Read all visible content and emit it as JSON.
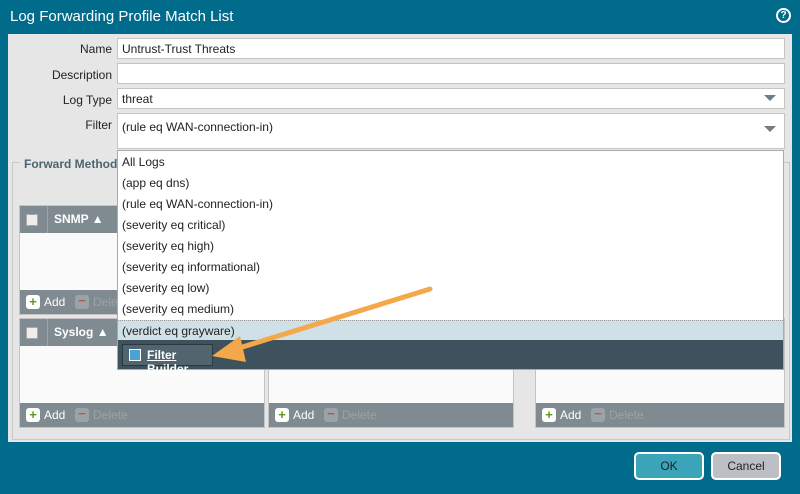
{
  "dialog": {
    "title": "Log Forwarding Profile Match List",
    "help_icon": "?"
  },
  "form": {
    "name_label": "Name",
    "name_value": "Untrust-Trust Threats",
    "description_label": "Description",
    "description_value": "",
    "log_type_label": "Log Type",
    "log_type_value": "threat",
    "filter_label": "Filter",
    "filter_value": "(rule eq WAN-connection-in)"
  },
  "forward_method": {
    "title": "Forward Method",
    "panels": [
      {
        "name": "SNMP"
      },
      {
        "name": "Syslog"
      }
    ],
    "add_label": "Add",
    "delete_label": "Delete"
  },
  "filter_dropdown": {
    "options": [
      "All Logs",
      "(app eq dns)",
      "(rule eq WAN-connection-in)",
      "(severity eq critical)",
      "(severity eq high)",
      "(severity eq informational)",
      "(severity eq low)",
      "(severity eq medium)",
      "(verdict eq grayware)"
    ],
    "highlighted": "(verdict eq grayware)",
    "filter_builder_label": "Filter Builder"
  },
  "footer": {
    "ok_label": "OK",
    "cancel_label": "Cancel"
  },
  "colors": {
    "frame": "#006b8a",
    "arrow": "#f5a84a",
    "ok": "#3aa4b9"
  }
}
